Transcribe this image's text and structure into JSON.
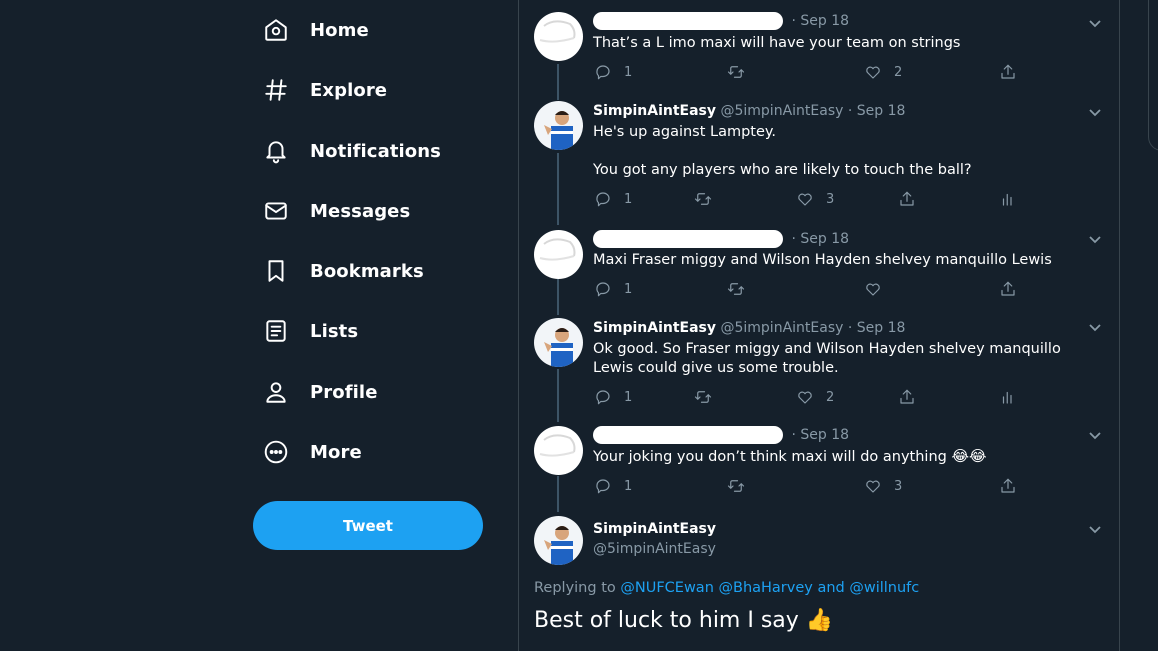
{
  "nav": {
    "items": [
      {
        "label": "Home",
        "icon": "home-icon"
      },
      {
        "label": "Explore",
        "icon": "hashtag-icon"
      },
      {
        "label": "Notifications",
        "icon": "bell-icon"
      },
      {
        "label": "Messages",
        "icon": "envelope-icon"
      },
      {
        "label": "Bookmarks",
        "icon": "bookmark-icon"
      },
      {
        "label": "Lists",
        "icon": "list-icon"
      },
      {
        "label": "Profile",
        "icon": "person-icon"
      },
      {
        "label": "More",
        "icon": "more-dots-icon"
      }
    ],
    "tweet_button": "Tweet"
  },
  "tweets": [
    {
      "redacted": true,
      "handle_sep": "·",
      "date": "Sep 18",
      "text": "That’s a L imo maxi will have your team on strings",
      "reply_count": "1",
      "retweet_count": "",
      "like_count": "2"
    },
    {
      "name": "SimpinAintEasy",
      "handle": "@5impinAintEasy",
      "handle_sep": "·",
      "date": "Sep 18",
      "text_line1": "He's up against Lamptey.",
      "text_line2": "You got any players who are likely to touch the ball?",
      "reply_count": "1",
      "retweet_count": "",
      "like_count": "3"
    },
    {
      "redacted": true,
      "handle_sep": "·",
      "date": "Sep 18",
      "text": "Maxi Fraser miggy and Wilson Hayden shelvey manquillo Lewis",
      "reply_count": "1",
      "retweet_count": "",
      "like_count": ""
    },
    {
      "name": "SimpinAintEasy",
      "handle": "@5impinAintEasy",
      "handle_sep": "·",
      "date": "Sep 18",
      "text": "Ok good. So Fraser miggy and Wilson Hayden shelvey manquillo Lewis could give us some trouble.",
      "reply_count": "1",
      "retweet_count": "",
      "like_count": "2"
    },
    {
      "redacted": true,
      "handle_sep": "·",
      "date": "Sep 18",
      "text": "Your joking you don’t think maxi will do anything",
      "emoji": "😂😂",
      "reply_count": "1",
      "retweet_count": "",
      "like_count": "3"
    }
  ],
  "focused": {
    "name": "SimpinAintEasy",
    "handle": "@5impinAintEasy",
    "replying_prefix": "Replying to",
    "mention1": "@NUFCEwan",
    "mention2": "@BhaHarvey",
    "and_text": "and",
    "mention3": "@willnufc",
    "text": "Best of luck to him I say",
    "emoji": "👍"
  },
  "colors": {
    "background": "#15202b",
    "accent": "#1da1f2",
    "muted": "#8899a6",
    "border": "#38444d"
  }
}
